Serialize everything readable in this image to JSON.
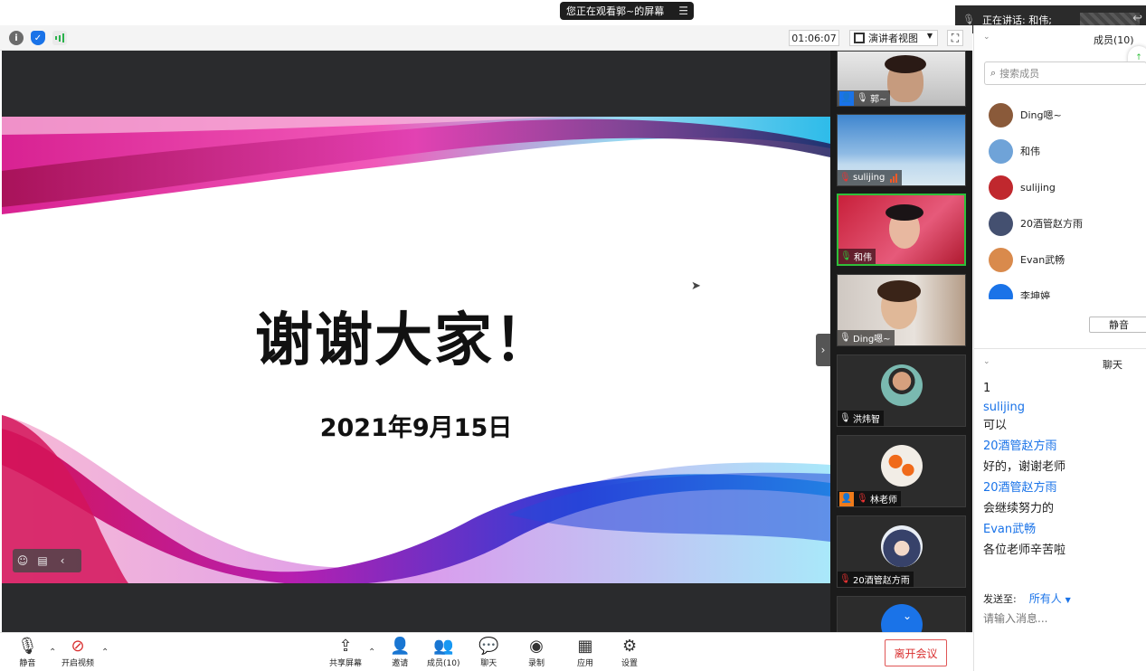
{
  "top_bar": {
    "viewing_label": "您正在观看郭~的屏幕",
    "menu_icon": "menu-lines-icon",
    "speaking_label": "正在讲话: 和伟;"
  },
  "status_bar": {
    "timer": "01:06:07",
    "view_mode": "演讲者视图",
    "icons": [
      "info-icon",
      "shield-icon",
      "signal-icon",
      "fullscreen-icon"
    ]
  },
  "slide": {
    "title": "谢谢大家！",
    "date": "2021年9月15日"
  },
  "videos": [
    {
      "name": "郭~",
      "mic": "on",
      "host_badge": true
    },
    {
      "name": "sulijing",
      "mic": "muted",
      "signal": true
    },
    {
      "name": "和伟",
      "mic": "active",
      "active": true
    },
    {
      "name": "Ding嗯~",
      "mic": "on"
    },
    {
      "name": "洪炜智",
      "mic": "on"
    },
    {
      "name": "林老师",
      "mic": "muted",
      "host_badge": true
    },
    {
      "name": "20酒管赵方雨",
      "mic": "muted"
    },
    {
      "name": "",
      "mic": "",
      "partial": true
    }
  ],
  "members_panel": {
    "title": "成员(10)",
    "search_placeholder": "搜索成员",
    "members": [
      {
        "name": "Ding嗯~",
        "color": "#8a5a3a"
      },
      {
        "name": "和伟",
        "color": "#6fa3d8"
      },
      {
        "name": "sulijing",
        "color": "#c0282e"
      },
      {
        "name": "20酒管赵方雨",
        "color": "#445070"
      },
      {
        "name": "Evan武畅",
        "color": "#d98a4c"
      },
      {
        "name": "李坤婷",
        "color": "#1a73e8"
      }
    ],
    "mute_all_label": "静音"
  },
  "chat_panel": {
    "title": "聊天",
    "messages": [
      {
        "text": "1",
        "type": "text"
      },
      {
        "text": "sulijing",
        "type": "sender"
      },
      {
        "text": "可以",
        "type": "text"
      },
      {
        "text": "20酒管赵方雨",
        "type": "sender"
      },
      {
        "text": "好的，谢谢老师",
        "type": "text"
      },
      {
        "text": "20酒管赵方雨",
        "type": "sender"
      },
      {
        "text": "会继续努力的",
        "type": "text"
      },
      {
        "text": "Evan武畅",
        "type": "sender"
      },
      {
        "text": "各位老师辛苦啦",
        "type": "text"
      }
    ],
    "send_to_label": "发送至:",
    "send_to_target": "所有人",
    "input_placeholder": "请输入消息..."
  },
  "bottom_bar": {
    "mute_label": "静音",
    "video_label": "开启视频",
    "share_label": "共享屏幕",
    "invite_label": "邀请",
    "members_label": "成员(10)",
    "chat_label": "聊天",
    "record_label": "录制",
    "apps_label": "应用",
    "settings_label": "设置",
    "leave_label": "离开会议"
  },
  "colors": {
    "accent": "#1a73e8",
    "active_speaker": "#2fbf3a",
    "leave": "#d93030"
  }
}
